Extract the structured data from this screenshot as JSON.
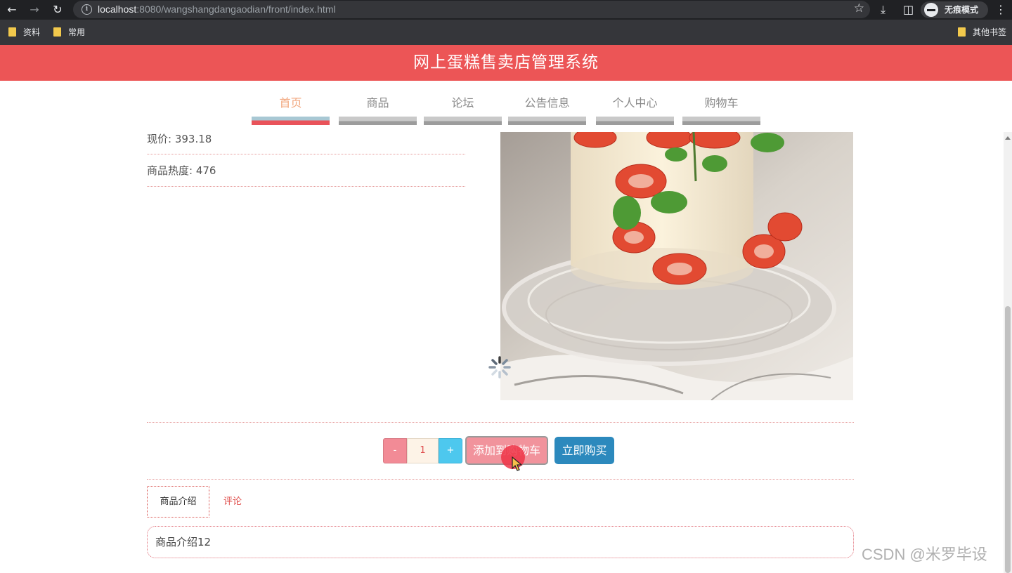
{
  "browser": {
    "url_host": "localhost",
    "url_rest": ":8080/wangshangdangaodian/front/index.html",
    "incognito_label": "无痕模式",
    "bookmarks": [
      "资料",
      "常用"
    ],
    "other_bookmarks": "其他书签"
  },
  "site": {
    "title": "网上蛋糕售卖店管理系统"
  },
  "nav": [
    {
      "label": "首页",
      "active": true
    },
    {
      "label": "商品",
      "active": false
    },
    {
      "label": "论坛",
      "active": false
    },
    {
      "label": "公告信息",
      "active": false
    },
    {
      "label": "个人中心",
      "active": false
    },
    {
      "label": "购物车",
      "active": false
    }
  ],
  "product": {
    "price_label": "现价: 393.18",
    "heat_label": "商品热度: 476"
  },
  "buy": {
    "minus": "-",
    "quantity": "1",
    "plus": "+",
    "add_to_cart": "添加到购物车",
    "buy_now": "立即购买"
  },
  "tabs": {
    "description": "商品介绍",
    "comments": "评论"
  },
  "description_text": "商品介绍12",
  "watermark": "CSDN @米罗毕设",
  "colors": {
    "header": "#ec5556",
    "active_tab_text": "#f2a77e",
    "buy_button": "#2c89bd",
    "cart_button": "#f1939c"
  }
}
